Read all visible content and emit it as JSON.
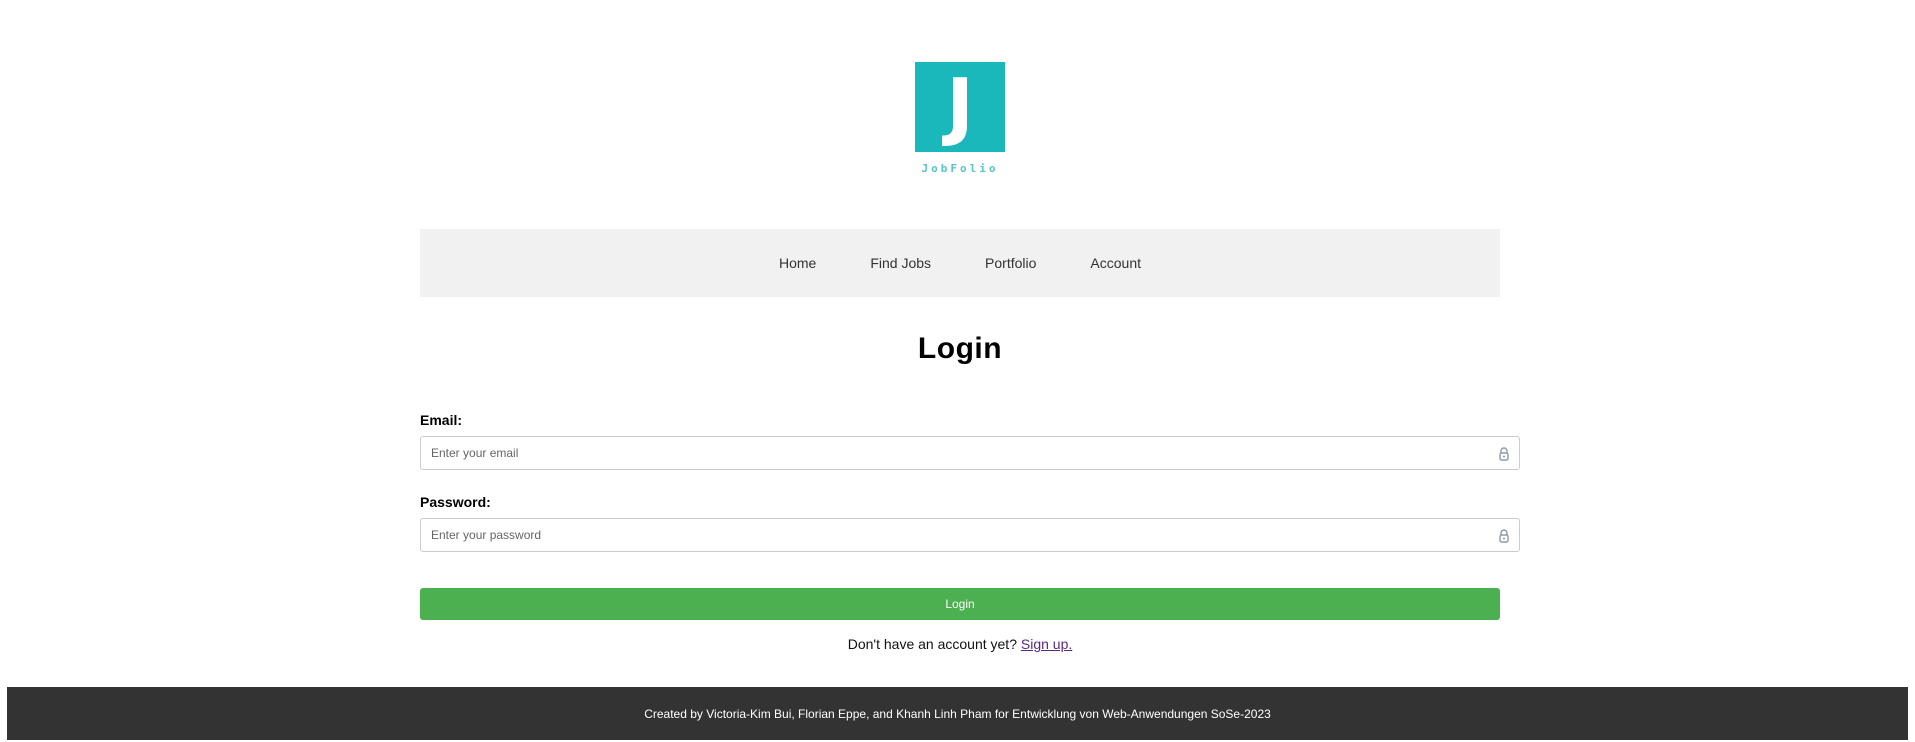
{
  "logo": {
    "letter": "J",
    "text": "JobFolio",
    "color": "#1ab8bb"
  },
  "nav": {
    "items": [
      {
        "label": "Home"
      },
      {
        "label": "Find Jobs"
      },
      {
        "label": "Portfolio"
      },
      {
        "label": "Account"
      }
    ]
  },
  "page": {
    "title": "Login"
  },
  "form": {
    "email": {
      "label": "Email:",
      "placeholder": "Enter your email",
      "value": "",
      "icon": "lock-icon"
    },
    "password": {
      "label": "Password:",
      "placeholder": "Enter your password",
      "value": "",
      "icon": "lock-icon"
    },
    "submit_label": "Login",
    "submit_color": "#4caf50"
  },
  "signup": {
    "prompt": "Don't have an account yet?",
    "link_label": "Sign up."
  },
  "footer": {
    "text": "Created by Victoria-Kim Bui, Florian Eppe, and Khanh Linh Pham for Entwicklung von Web-Anwendungen SoSe-2023",
    "background": "#333333"
  }
}
